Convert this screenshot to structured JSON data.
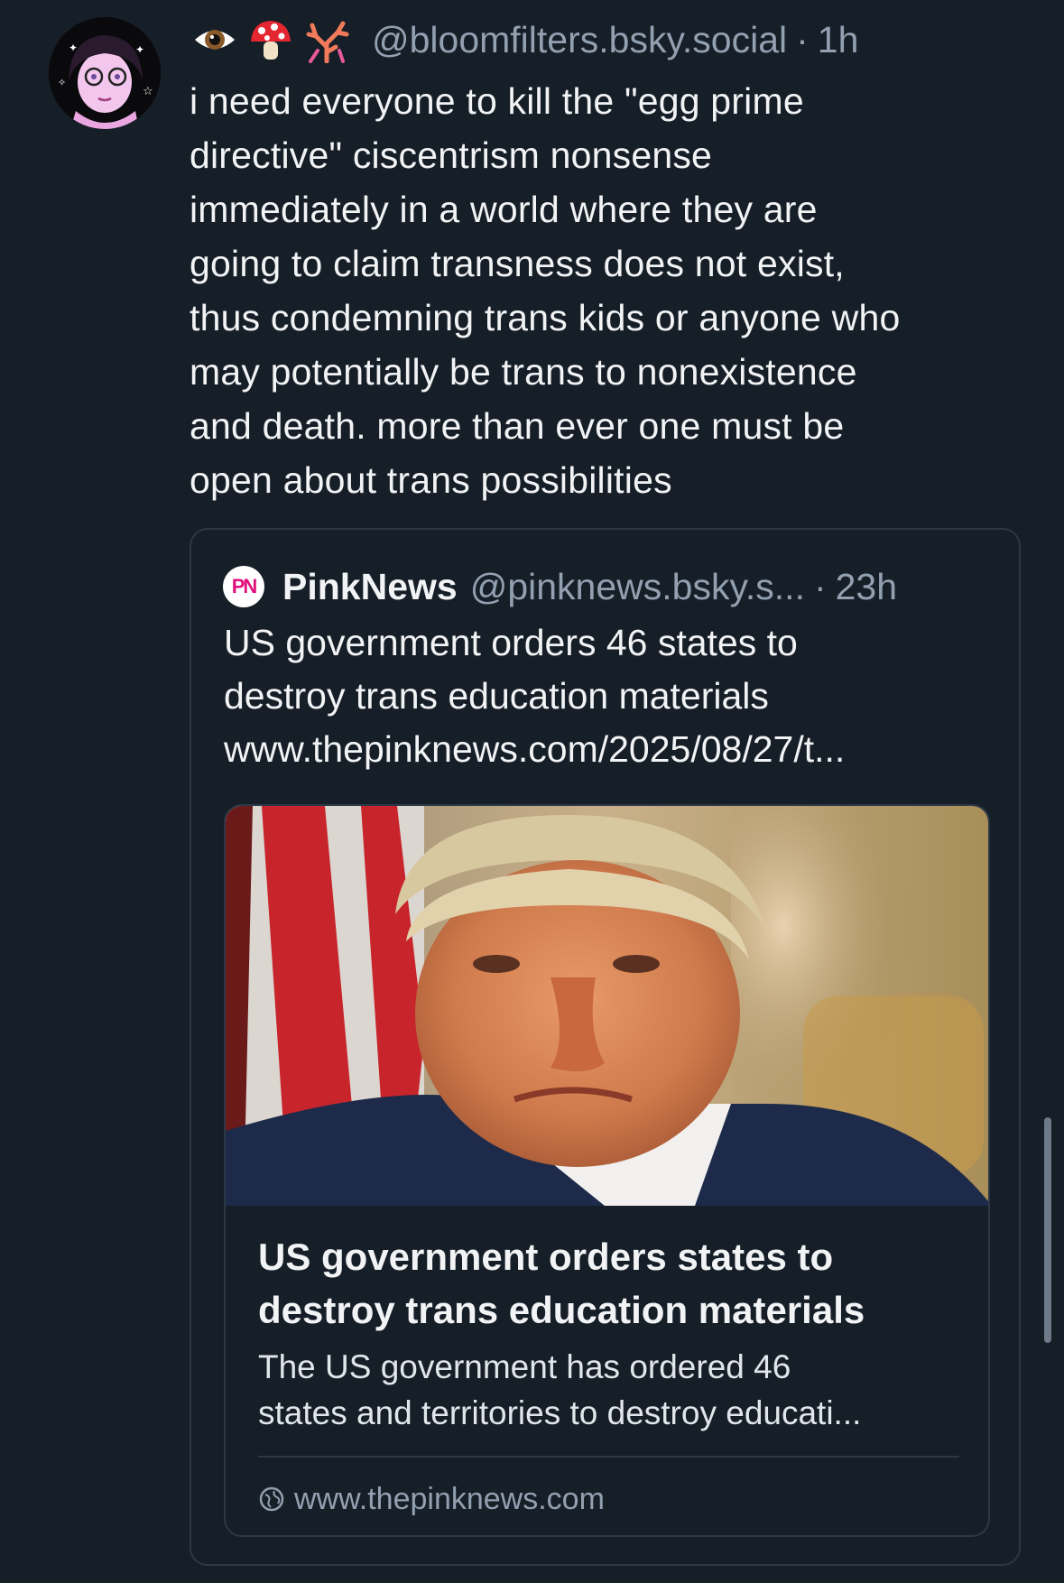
{
  "post": {
    "author_handle": "@bloomfilters.bsky.social",
    "separator": "·",
    "time": "1h",
    "emojis": [
      "eye-emoji",
      "mushroom-emoji",
      "coral-emoji"
    ],
    "text_lines": [
      "i need everyone to kill the \"egg prime",
      "directive\" ciscentrism nonsense",
      "immediately in a world where they are",
      "going to claim transness does not exist,",
      "thus condemning trans kids or anyone who",
      "may potentially be trans to nonexistence",
      "and death. more than ever one must be",
      "open about trans possibilities"
    ]
  },
  "quote": {
    "logo_text": "PN",
    "author_name": "PinkNews",
    "author_handle": "@pinknews.bsky.s...",
    "separator": "·",
    "time": "23h",
    "text_lines": [
      "US government orders 46 states to",
      "destroy trans education materials",
      "www.thepinknews.com/2025/08/27/t..."
    ],
    "card": {
      "image_icon": "news-photo",
      "title_lines": [
        "US government orders states to",
        "destroy trans education materials"
      ],
      "description_lines": [
        "The US government has ordered 46",
        "states and territories to destroy educati..."
      ],
      "domain": "www.thepinknews.com",
      "domain_icon": "globe-icon"
    }
  },
  "colors": {
    "background": "#161e27",
    "text_primary": "#f1f3f5",
    "text_secondary": "#93a0b0",
    "border": "#2c3846",
    "brand_pink": "#e0117e"
  }
}
